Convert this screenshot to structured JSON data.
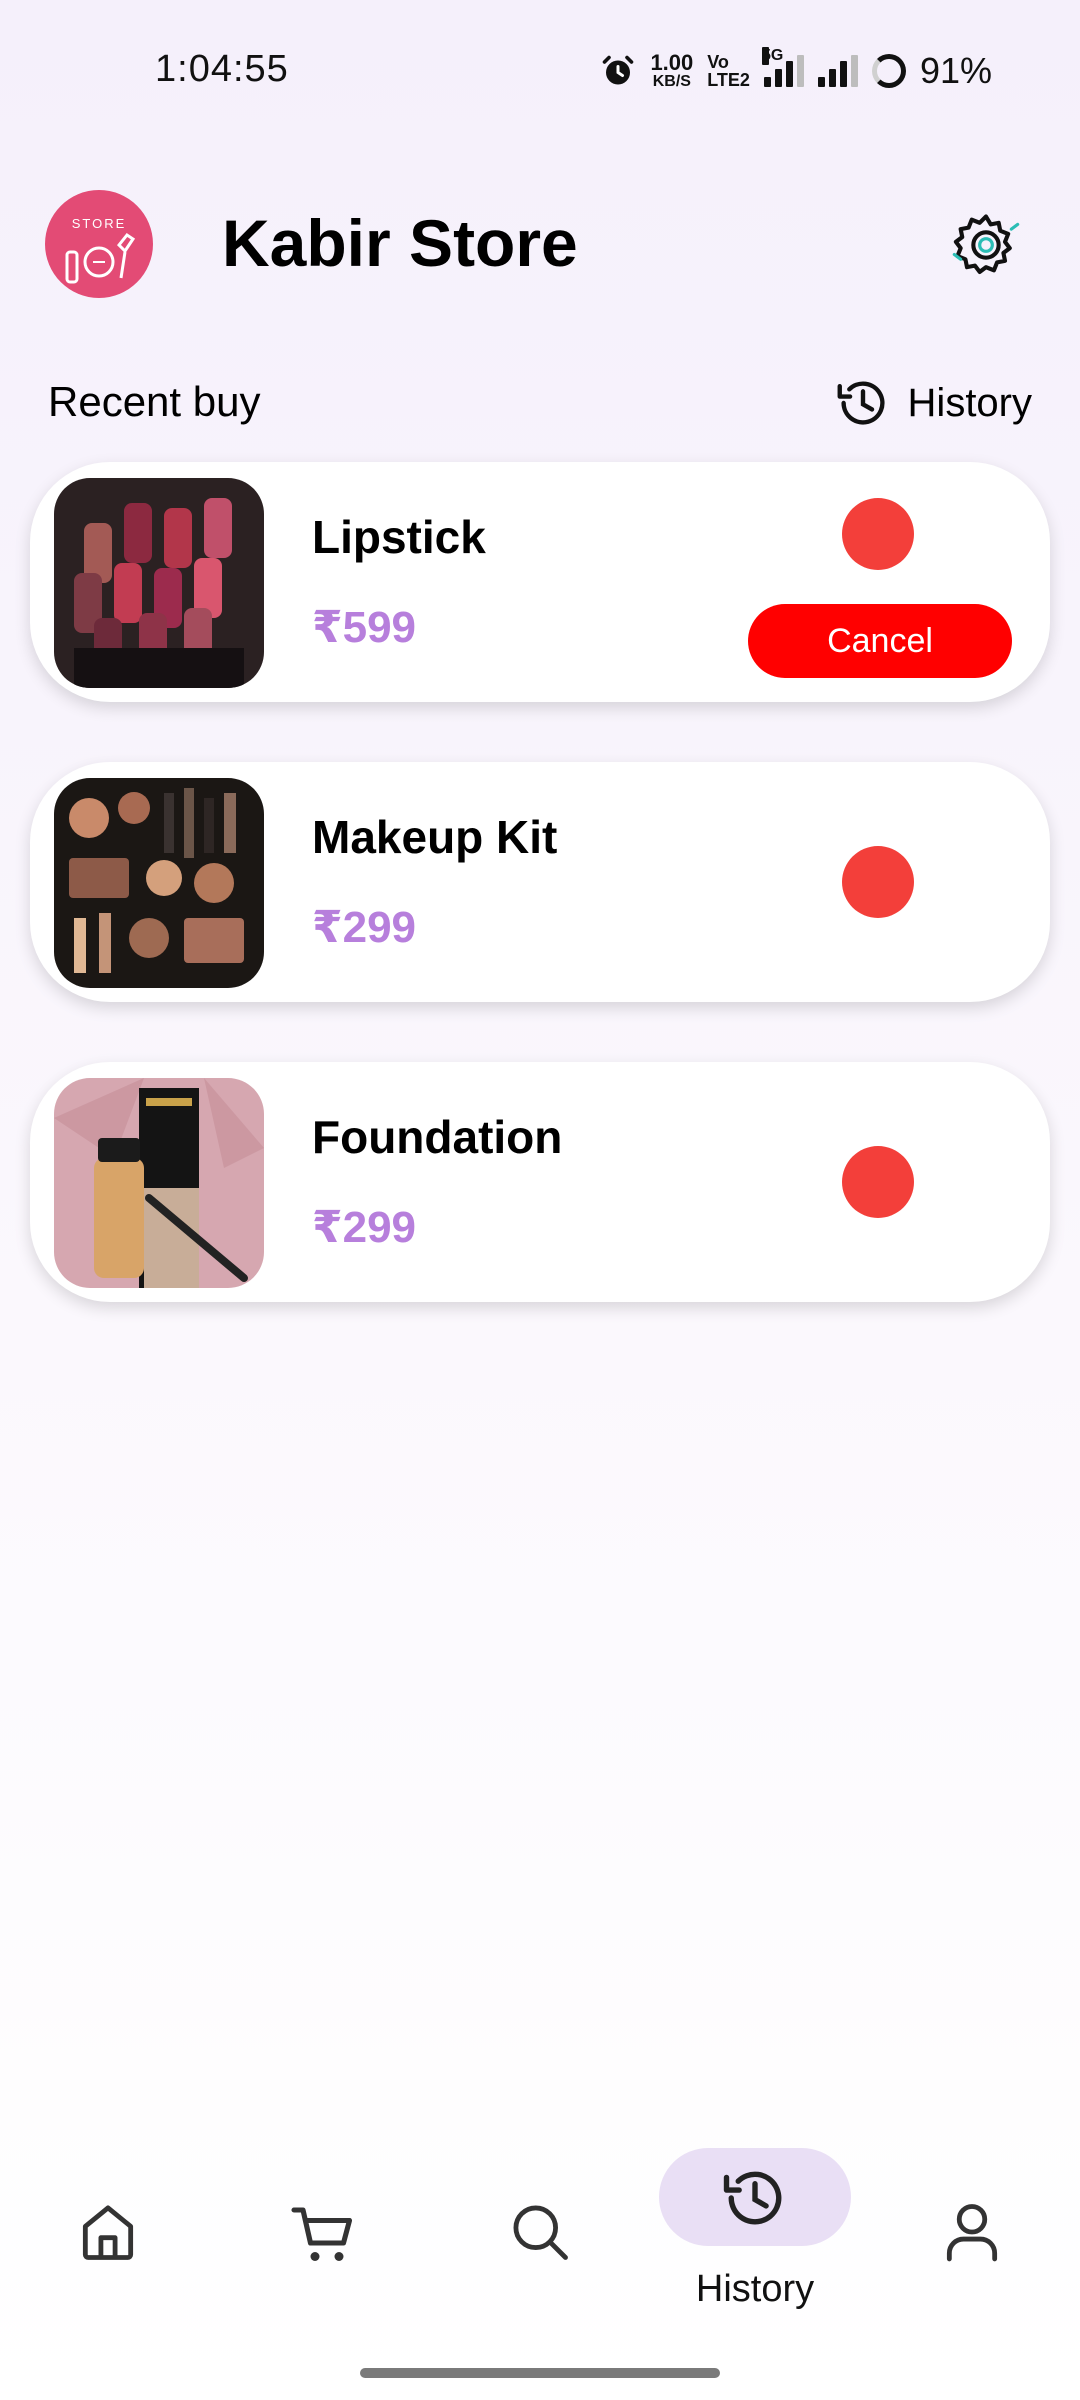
{
  "status_bar": {
    "time": "1:04:55",
    "net_speed_value": "1.00",
    "net_speed_unit": "KB/S",
    "volte_top": "Vo",
    "volte_bottom": "LTE2",
    "network_type": "5G",
    "battery": "91%"
  },
  "header": {
    "logo_text": "STORE",
    "title": "Kabir Store",
    "settings_icon": "gear-icon"
  },
  "section": {
    "title": "Recent buy",
    "history_label": "History"
  },
  "orders": [
    {
      "name": "Lipstick",
      "price": "₹599",
      "status_color": "#f33f3a",
      "cancel_label": "Cancel"
    },
    {
      "name": "Makeup Kit",
      "price": "₹299",
      "status_color": "#f33f3a"
    },
    {
      "name": "Foundation",
      "price": "₹299",
      "status_color": "#f33f3a"
    }
  ],
  "nav": {
    "active": "history",
    "history_label": "History",
    "items": [
      "home-icon",
      "cart-icon",
      "search-icon",
      "history-icon",
      "profile-icon"
    ]
  },
  "colors": {
    "accent": "#e9dff5",
    "price": "#b77fdc",
    "cancel": "#ff0000",
    "status_dot": "#f33f3a",
    "logo": "#e34b75"
  }
}
